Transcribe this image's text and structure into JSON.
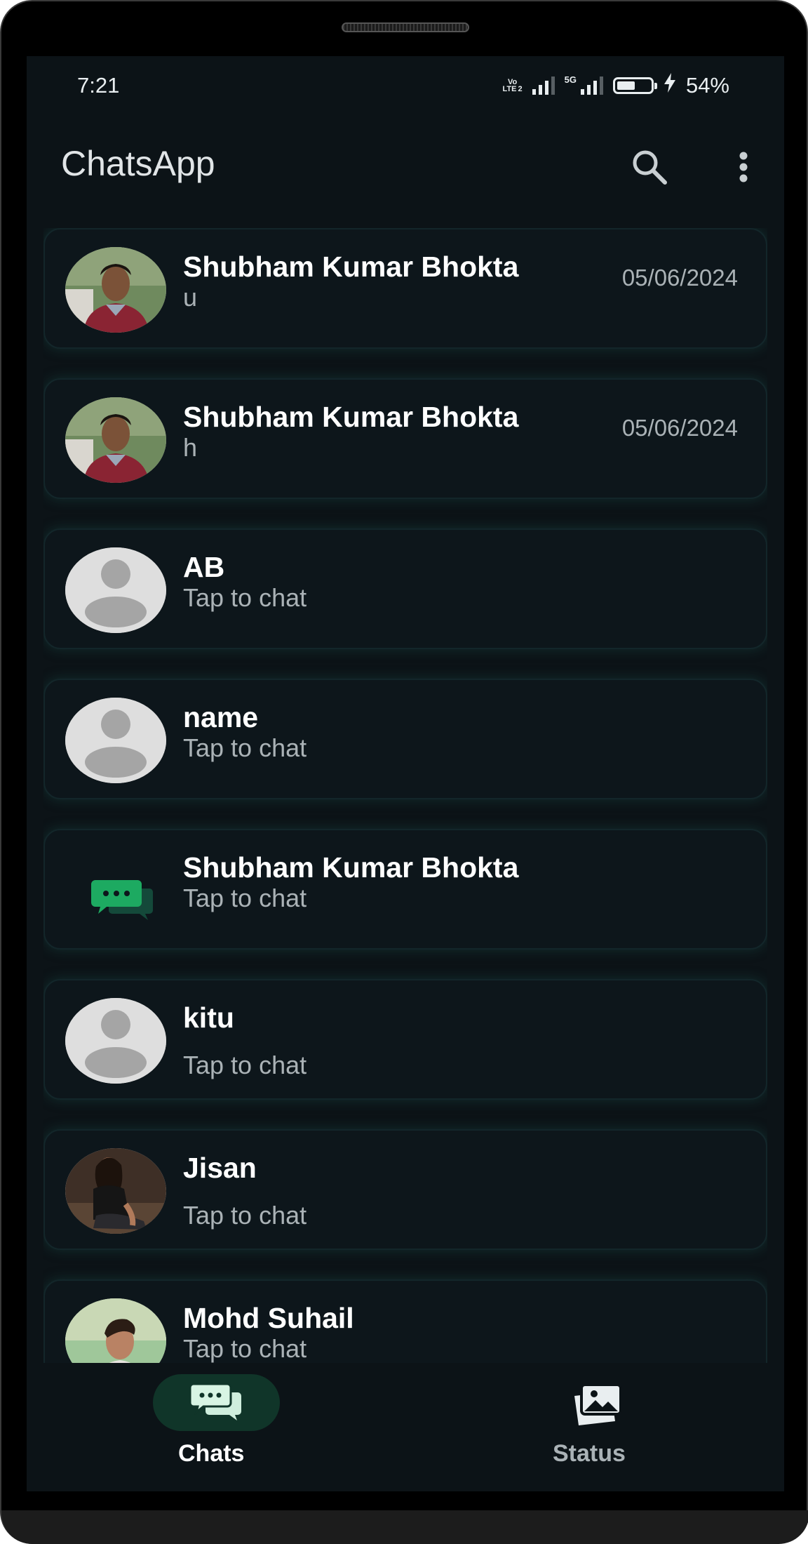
{
  "status_bar": {
    "time": "7:21",
    "network_badge_top": "Vo",
    "network_badge_mid": "LTE",
    "network_badge_num": "2",
    "fiveg": "5G",
    "battery_percent_text": "54%",
    "battery_level": 0.54
  },
  "app_bar": {
    "title": "ChatsApp",
    "search_icon": "search-icon",
    "menu_icon": "more-vert-icon"
  },
  "chats": [
    {
      "name": "Shubham Kumar Bhokta",
      "message": "u",
      "date": "05/06/2024",
      "avatar": "photo-man"
    },
    {
      "name": "Shubham Kumar Bhokta",
      "message": "h",
      "date": "05/06/2024",
      "avatar": "photo-man"
    },
    {
      "name": "AB",
      "message": "Tap to chat",
      "date": "",
      "avatar": "default-person"
    },
    {
      "name": "name",
      "message": "Tap to chat",
      "date": "",
      "avatar": "default-person"
    },
    {
      "name": "Shubham Kumar Bhokta",
      "message": "Tap to chat",
      "date": "",
      "avatar": "chat-bubbles"
    },
    {
      "name": "kitu",
      "message": "Tap to chat",
      "date": "",
      "avatar": "default-person"
    },
    {
      "name": "Jisan",
      "message": "Tap to chat",
      "date": "",
      "avatar": "photo-woman"
    },
    {
      "name": "Mohd Suhail",
      "message": "Tap to chat",
      "date": "",
      "avatar": "photo-boy"
    }
  ],
  "bottom_nav": {
    "chats_label": "Chats",
    "status_label": "Status",
    "active": "Chats"
  },
  "colors": {
    "background": "#0c1317",
    "card": "#0d161b",
    "accent_green": "#1daa61",
    "active_pill": "#103529"
  }
}
